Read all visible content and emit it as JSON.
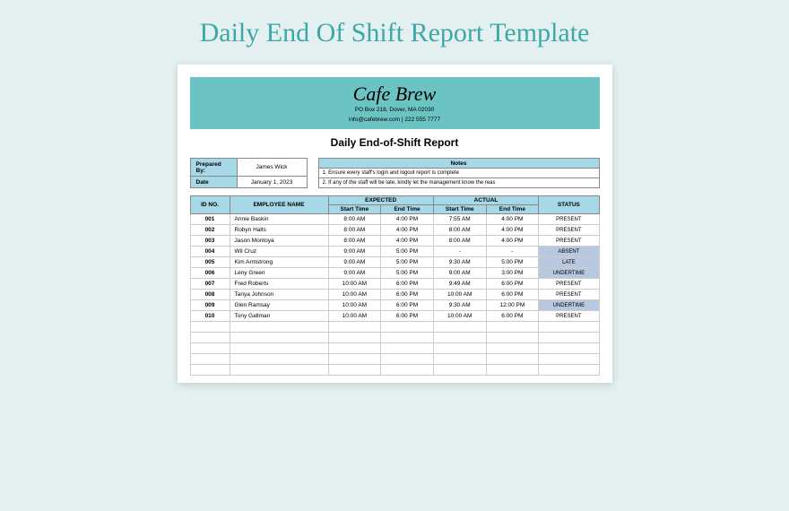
{
  "page_title": "Daily End Of Shift Report Template",
  "brand": {
    "name": "Cafe Brew",
    "address": "PO Box 218, Dover, MA 02030",
    "contact": "info@cafebrew.com | 222 555 7777"
  },
  "report_title": "Daily End-of-Shift Report",
  "meta": {
    "prepared_by_label": "Prepared By:",
    "prepared_by_value": "James Wick",
    "date_label": "Date",
    "date_value": "January 1, 2023",
    "notes_header": "Notes",
    "note1": "1. Ensure every staff's login and logout report is complete",
    "note2": "2. If any of the staff will be late, kindly let the management know the reas"
  },
  "headers": {
    "id": "ID NO.",
    "name": "EMPLOYEE NAME",
    "expected": "EXPECTED",
    "actual": "ACTUAL",
    "start": "Start Time",
    "end": "End Time",
    "status": "STATUS"
  },
  "rows": [
    {
      "id": "001",
      "name": "Annie Baskin",
      "es": "8:00 AM",
      "ee": "4:00 PM",
      "as": "7:55 AM",
      "ae": "4:00 PM",
      "status": "PRESENT",
      "alt": false
    },
    {
      "id": "002",
      "name": "Robyn Halts",
      "es": "8:00 AM",
      "ee": "4:00 PM",
      "as": "8:00 AM",
      "ae": "4:00 PM",
      "status": "PRESENT",
      "alt": false
    },
    {
      "id": "003",
      "name": "Jason Montoya",
      "es": "8:00 AM",
      "ee": "4:00 PM",
      "as": "8:00 AM",
      "ae": "4:00 PM",
      "status": "PRESENT",
      "alt": false
    },
    {
      "id": "004",
      "name": "Wil Cruz",
      "es": "9:00 AM",
      "ee": "5:00 PM",
      "as": "-",
      "ae": "-",
      "status": "ABSENT",
      "alt": true
    },
    {
      "id": "005",
      "name": "Kim Armstrong",
      "es": "9:00 AM",
      "ee": "5:00 PM",
      "as": "9:30 AM",
      "ae": "5:00 PM",
      "status": "LATE",
      "alt": true
    },
    {
      "id": "006",
      "name": "Leny Green",
      "es": "9:00 AM",
      "ee": "5:00 PM",
      "as": "9:00 AM",
      "ae": "3:00 PM",
      "status": "UNDERTIME",
      "alt": true
    },
    {
      "id": "007",
      "name": "Fred Roberts",
      "es": "10:00 AM",
      "ee": "6:00 PM",
      "as": "9:49 AM",
      "ae": "6:00 PM",
      "status": "PRESENT",
      "alt": false
    },
    {
      "id": "008",
      "name": "Tanya Johnson",
      "es": "10:00 AM",
      "ee": "6:00 PM",
      "as": "10:00 AM",
      "ae": "6:00 PM",
      "status": "PRESENT",
      "alt": false
    },
    {
      "id": "009",
      "name": "Glen Ramsay",
      "es": "10:00 AM",
      "ee": "6:00 PM",
      "as": "9:30 AM",
      "ae": "12:00 PM",
      "status": "UNDERTIME",
      "alt": true
    },
    {
      "id": "010",
      "name": "Tony Gallman",
      "es": "10:00 AM",
      "ee": "6:00 PM",
      "as": "10:00 AM",
      "ae": "6:00 PM",
      "status": "PRESENT",
      "alt": false
    }
  ],
  "empty_rows": 5
}
